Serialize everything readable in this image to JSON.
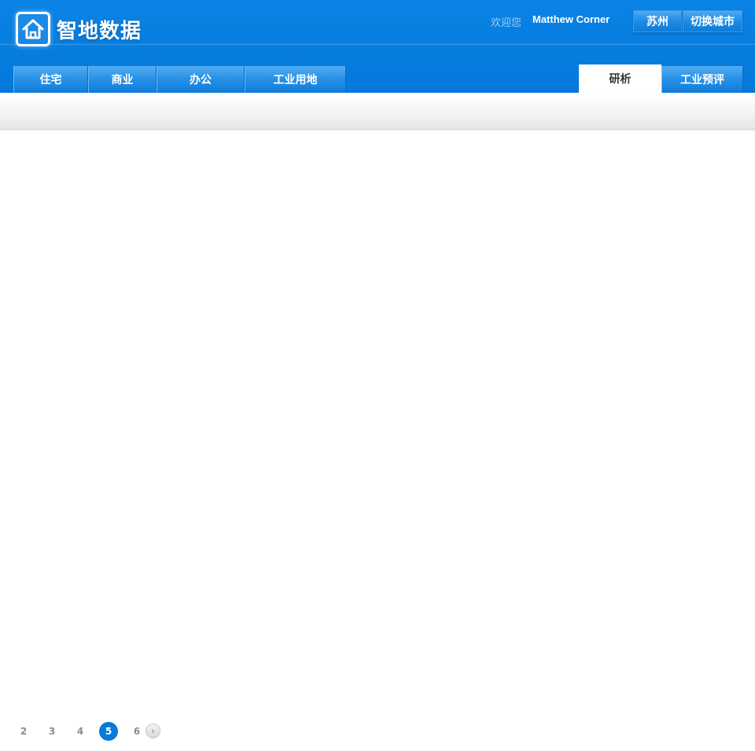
{
  "header": {
    "logo_text": "智地数据",
    "welcome_text": "欢迎您",
    "user_name": "Matthew Corner",
    "city_label": "苏州",
    "switch_city_label": "切换城市"
  },
  "nav": {
    "left_tabs": [
      {
        "label": "住宅"
      },
      {
        "label": "商业"
      },
      {
        "label": "办公"
      },
      {
        "label": "工业用地"
      }
    ],
    "right_tabs": [
      {
        "label": "研析",
        "active": true
      },
      {
        "label": "工业预评",
        "active": false
      }
    ]
  },
  "pagination": {
    "pages": [
      "2",
      "3",
      "4",
      "5",
      "6"
    ],
    "current": "5",
    "next_icon": "chevron-right-icon"
  },
  "colors": {
    "brand_blue": "#077ee0",
    "current_page": "#0a7ad8"
  }
}
